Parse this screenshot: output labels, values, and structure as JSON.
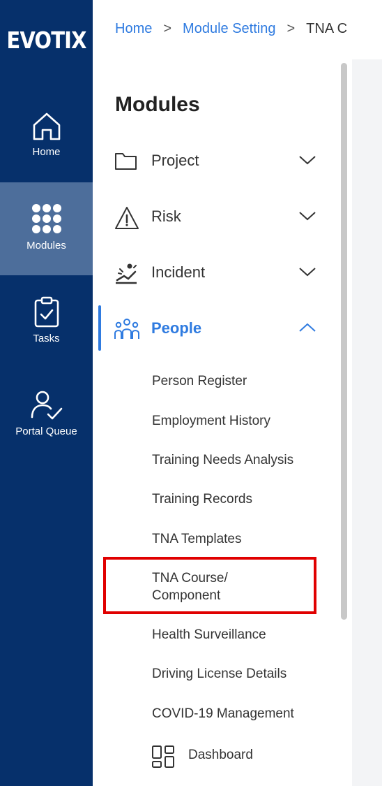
{
  "rail": {
    "logo": "EVOTIX",
    "items": [
      {
        "label": "Home",
        "icon": "home-icon"
      },
      {
        "label": "Modules",
        "icon": "grid-dots-icon"
      },
      {
        "label": "Tasks",
        "icon": "clipboard-check-icon"
      },
      {
        "label": "Portal Queue",
        "icon": "user-check-icon"
      }
    ]
  },
  "breadcrumb": {
    "items": [
      "Home",
      "Module Setting"
    ],
    "current": "TNA C"
  },
  "sidebar": {
    "title": "Modules",
    "modules": [
      {
        "label": "Project",
        "icon": "folder-icon"
      },
      {
        "label": "Risk",
        "icon": "warning-icon"
      },
      {
        "label": "Incident",
        "icon": "incident-icon"
      },
      {
        "label": "People",
        "icon": "people-icon"
      }
    ],
    "people_items": [
      "Person Register",
      "Employment History",
      "Training Needs Analysis",
      "Training Records",
      "TNA Templates",
      "TNA Course/ Component",
      "Health Surveillance",
      "Driving License Details",
      "COVID-19 Management"
    ],
    "dashboard": "Dashboard"
  },
  "colors": {
    "rail_bg": "#06306b",
    "rail_active": "#4d6e9b",
    "accent": "#2f7be0",
    "highlight": "#e00000"
  }
}
